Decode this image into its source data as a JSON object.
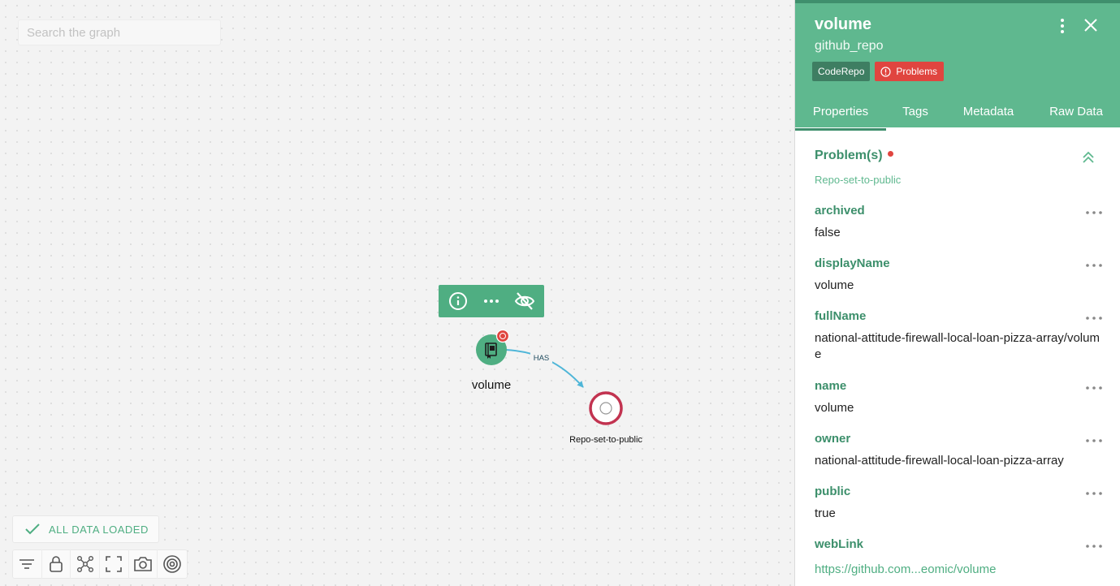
{
  "search": {
    "placeholder": "Search the graph"
  },
  "graph": {
    "nodes": [
      {
        "label": "volume",
        "icon": "repo-book-icon",
        "has_problem": true
      },
      {
        "label": "Repo-set-to-public",
        "icon": "problem-ring-icon"
      }
    ],
    "edges": [
      {
        "label": "HAS"
      }
    ],
    "node_toolbar": {
      "icons": [
        "info-icon",
        "more-icon",
        "eye-slash-icon"
      ]
    }
  },
  "status": {
    "text": "ALL DATA LOADED"
  },
  "bottom_toolbar": {
    "icons": [
      "filter-icon",
      "lock-icon",
      "layout-network-icon",
      "fullscreen-icon",
      "camera-icon",
      "target-icon"
    ]
  },
  "panel": {
    "title": "volume",
    "subtitle": "github_repo",
    "badges": {
      "type": "CodeRepo",
      "problems": "Problems"
    },
    "tabs": [
      "Properties",
      "Tags",
      "Metadata",
      "Raw Data"
    ],
    "active_tab": "Properties",
    "problems": {
      "heading": "Problem(s)",
      "items": [
        "Repo-set-to-public"
      ]
    },
    "properties": [
      {
        "key": "archived",
        "value": "false"
      },
      {
        "key": "displayName",
        "value": "volume"
      },
      {
        "key": "fullName",
        "value": "national-attitude-firewall-local-loan-pizza-array/volume"
      },
      {
        "key": "name",
        "value": "volume"
      },
      {
        "key": "owner",
        "value": "national-attitude-firewall-local-loan-pizza-array"
      },
      {
        "key": "public",
        "value": "true"
      },
      {
        "key": "webLink",
        "value": "https://github.com...eomic/volume"
      }
    ]
  },
  "colors": {
    "accent": "#5fb88f",
    "accent_dark": "#3c8f6b",
    "problem_red": "#e0453f",
    "edge_blue": "#4fb6d8",
    "ring_red": "#c23350"
  }
}
